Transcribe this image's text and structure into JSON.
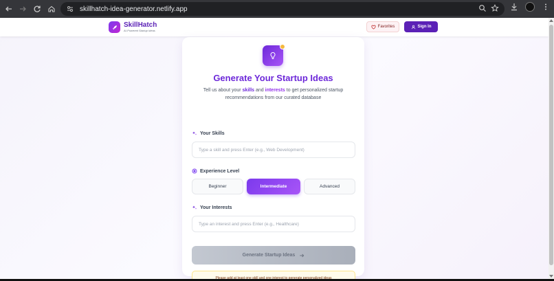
{
  "browser": {
    "url": "skillhatch-idea-generator.netlify.app"
  },
  "header": {
    "brand_name": "SkillHatch",
    "brand_tagline": "AI-Powered Startup Ideas",
    "favorites_label": "Favorites",
    "signin_label": "Sign In"
  },
  "card": {
    "title": "Generate Your Startup Ideas",
    "subtitle_pre": "Tell us about your ",
    "subtitle_skills": "skills",
    "subtitle_and": " and ",
    "subtitle_interests": "interests",
    "subtitle_post": " to get personalized startup recommendations from our curated database",
    "skills_label": "Your Skills",
    "skills_placeholder": "Type a skill and press Enter (e.g., Web Development)",
    "experience_label": "Experience Level",
    "levels": [
      "Beginner",
      "Intermediate",
      "Advanced"
    ],
    "selected_level": "Intermediate",
    "interests_label": "Your Interests",
    "interests_placeholder": "Type an interest and press Enter (e.g., Healthcare)",
    "generate_label": "Generate Startup Ideas",
    "notice": "Please add at least one skill and one interest to generate personalized ideas"
  },
  "colors": {
    "brand_primary": "#6d28d9",
    "brand_accent": "#a855f7",
    "notice_bg": "#fffbeb"
  },
  "icons": {
    "logo": "rocket-icon",
    "favorites": "heart-icon",
    "signin": "user-icon",
    "hero": "lightbulb-icon",
    "skills": "sparkles-icon",
    "experience": "target-icon",
    "interests": "sparkles-icon",
    "generate": "arrow-right-icon"
  }
}
